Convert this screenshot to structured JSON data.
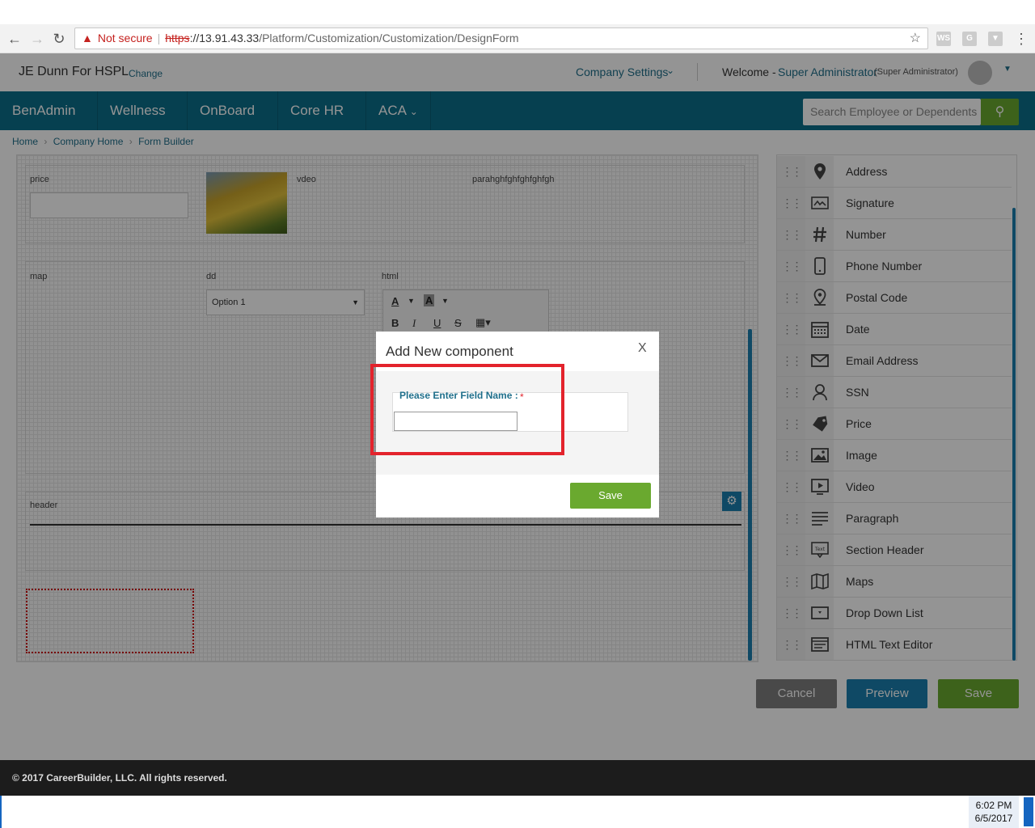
{
  "browser": {
    "not_secure": "Not secure",
    "url_scheme": "https",
    "url_rest": "://13.91.43.33",
    "url_path": "/Platform/Customization/Customization/DesignForm"
  },
  "header": {
    "company": "JE Dunn For HSPL",
    "change": "Change",
    "company_settings": "Company Settings",
    "welcome": "Welcome -",
    "user": "Super Administrator",
    "role": "(Super Administrator)"
  },
  "nav": {
    "items": [
      "BenAdmin",
      "Wellness",
      "OnBoard",
      "Core HR",
      "ACA"
    ],
    "search_placeholder": "Search Employee or Dependents"
  },
  "breadcrumb": [
    "Home",
    "Company Home",
    "Form Builder"
  ],
  "canvas": {
    "price_label": "price",
    "vdeo_label": "vdeo",
    "para_label": "parahghfghfghfghfgh",
    "map_label": "map",
    "dd_label": "dd",
    "dd_value": "Option 1",
    "html_label": "html",
    "header_label": "header"
  },
  "palette": [
    {
      "label": "Address",
      "icon": "map-pin-icon"
    },
    {
      "label": "Signature",
      "icon": "signature-icon"
    },
    {
      "label": "Number",
      "icon": "hash-icon"
    },
    {
      "label": "Phone Number",
      "icon": "phone-icon"
    },
    {
      "label": "Postal Code",
      "icon": "postal-pin-icon"
    },
    {
      "label": "Date",
      "icon": "calendar-icon"
    },
    {
      "label": "Email Address",
      "icon": "envelope-icon"
    },
    {
      "label": "SSN",
      "icon": "person-icon"
    },
    {
      "label": "Price",
      "icon": "tag-icon"
    },
    {
      "label": "Image",
      "icon": "image-icon"
    },
    {
      "label": "Video",
      "icon": "video-icon"
    },
    {
      "label": "Paragraph",
      "icon": "paragraph-icon"
    },
    {
      "label": "Section Header",
      "icon": "text-bubble-icon"
    },
    {
      "label": "Maps",
      "icon": "map-icon"
    },
    {
      "label": "Drop Down List",
      "icon": "dropdown-icon"
    },
    {
      "label": "HTML Text Editor",
      "icon": "editor-icon"
    }
  ],
  "actions": {
    "cancel": "Cancel",
    "preview": "Preview",
    "save": "Save"
  },
  "modal": {
    "title": "Add New component",
    "close": "X",
    "field_label": "Please Enter Field Name :",
    "required": "*",
    "field_value": "",
    "save": "Save"
  },
  "footer": {
    "copyright": "© 2017 CareerBuilder, LLC. All rights reserved."
  },
  "taskbar": {
    "time": "6:02 PM",
    "date": "6/5/2017"
  },
  "colors": {
    "navbar": "#0c6e8b",
    "green": "#6aa92f",
    "preview": "#1a7fae",
    "cancel": "#7f7f7f",
    "highlight": "#e3232c"
  }
}
